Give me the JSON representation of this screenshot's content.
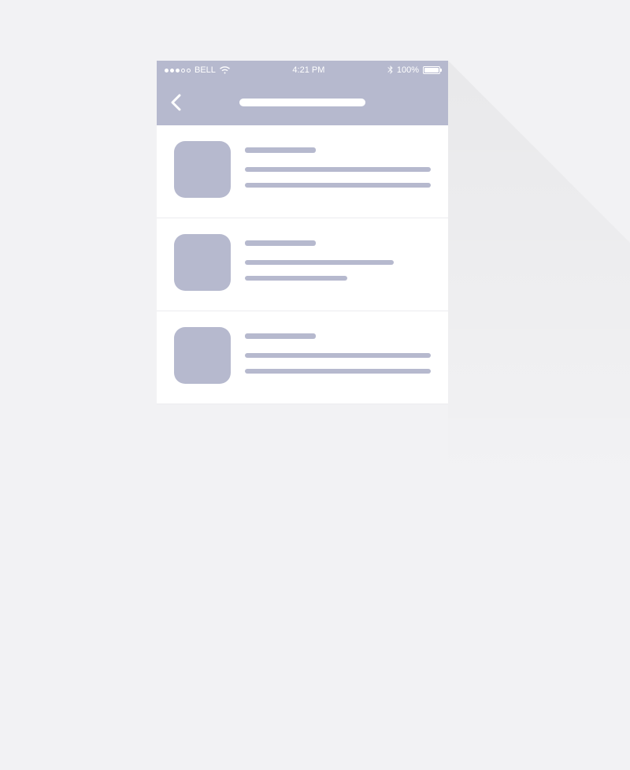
{
  "status_bar": {
    "carrier": "BELL",
    "time": "4:21 PM",
    "battery_pct": "100%",
    "signal_dots_filled": 3,
    "signal_dots_total": 5
  },
  "nav": {
    "back_label": "Back"
  },
  "list": {
    "items": [
      {
        "id": 1
      },
      {
        "id": 2
      },
      {
        "id": 3
      }
    ]
  },
  "colors": {
    "accent": "#b6b9ce",
    "bg": "#f2f2f4"
  }
}
